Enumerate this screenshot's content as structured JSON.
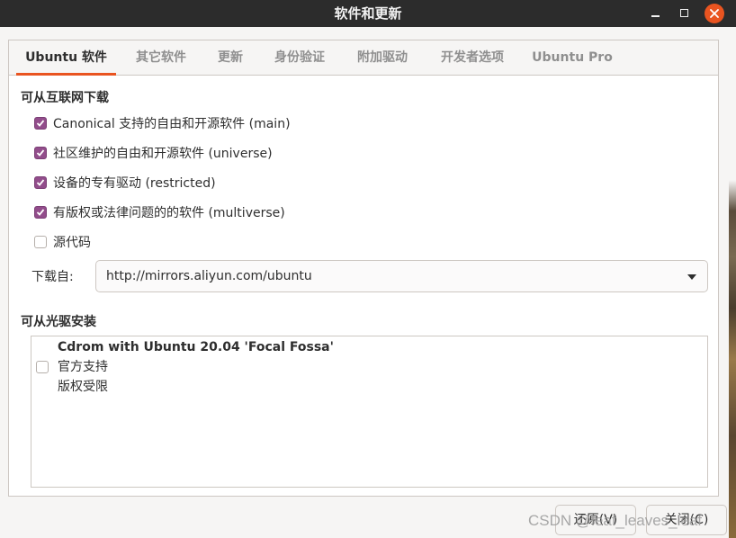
{
  "window": {
    "title": "软件和更新"
  },
  "tabs": [
    {
      "label": "Ubuntu 软件",
      "active": true
    },
    {
      "label": "其它软件"
    },
    {
      "label": "更新"
    },
    {
      "label": "身份验证"
    },
    {
      "label": "附加驱动"
    },
    {
      "label": "开发者选项"
    },
    {
      "label": "Ubuntu Pro"
    }
  ],
  "internet": {
    "title": "可从互联网下载",
    "options": [
      {
        "label": "Canonical 支持的自由和开源软件 (main)",
        "checked": true
      },
      {
        "label": "社区维护的自由和开源软件 (universe)",
        "checked": true
      },
      {
        "label": "设备的专有驱动 (restricted)",
        "checked": true
      },
      {
        "label": "有版权或法律问题的的软件 (multiverse)",
        "checked": true
      },
      {
        "label": "源代码",
        "checked": false
      }
    ],
    "download_label": "下载自:",
    "download_value": "http://mirrors.aliyun.com/ubuntu"
  },
  "cdrom": {
    "title": "可从光驱安装",
    "item": {
      "name": "Cdrom with Ubuntu 20.04 'Focal Fossa'",
      "line2": "官方支持",
      "line3": "版权受限",
      "checked": false
    }
  },
  "buttons": {
    "revert": "还原(V)",
    "close": "关闭(C)"
  },
  "watermark": "CSDN @leaf_leaves_leaf",
  "colors": {
    "accent": "#e95420",
    "checkbox": "#924d8b",
    "titlebar": "#2c2c2c"
  }
}
